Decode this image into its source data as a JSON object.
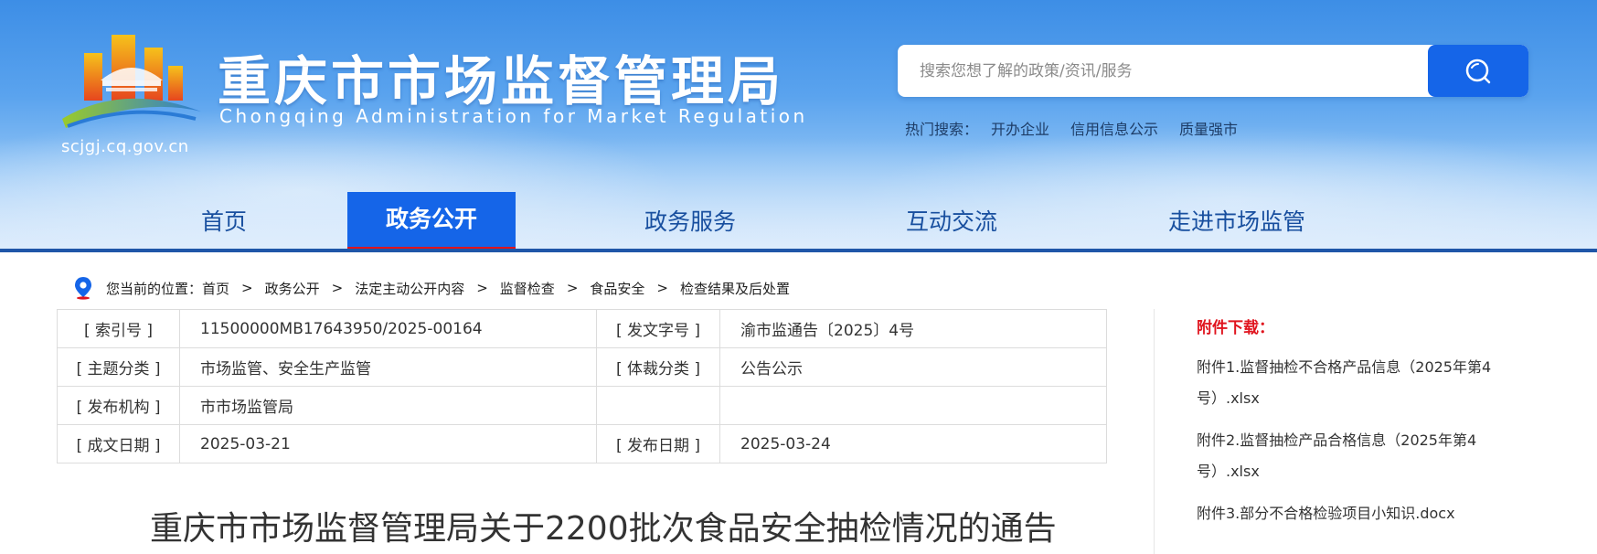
{
  "header": {
    "title": "重庆市市场监督管理局",
    "subtitle": "Chongqing  Administration for Market Regulation",
    "domain": "scjgj.cq.gov.cn"
  },
  "search": {
    "placeholder": "搜索您想了解的政策/资讯/服务",
    "value": "",
    "icon": "search-icon",
    "hot_label": "热门搜索：",
    "hot_links": [
      "开办企业",
      "信用信息公示",
      "质量强市"
    ]
  },
  "nav": {
    "items": [
      {
        "label": "首页",
        "active": false
      },
      {
        "label": "政务公开",
        "active": true
      },
      {
        "label": "政务服务",
        "active": false
      },
      {
        "label": "互动交流",
        "active": false
      },
      {
        "label": "走进市场监管",
        "active": false
      }
    ]
  },
  "breadcrumb": {
    "prefix": "您当前的位置：",
    "items": [
      "首页",
      "政务公开",
      "法定主动公开内容",
      "监督检查",
      "食品安全",
      "检查结果及后处置"
    ],
    "separator": ">"
  },
  "meta": {
    "rows": [
      {
        "k1": "[ 索引号 ]",
        "v1": "11500000MB17643950/2025-00164",
        "k2": "[ 发文字号 ]",
        "v2": "渝市监通告〔2025〕4号"
      },
      {
        "k1": "[ 主题分类 ]",
        "v1": "市场监管、安全生产监管",
        "k2": "[ 体裁分类 ]",
        "v2": "公告公示"
      },
      {
        "k1": "[ 发布机构 ]",
        "v1": "市市场监管局",
        "k2": "",
        "v2": ""
      },
      {
        "k1": "[ 成文日期 ]",
        "v1": "2025-03-21",
        "k2": "[ 发布日期 ]",
        "v2": "2025-03-24"
      }
    ]
  },
  "article": {
    "title": "重庆市市场监督管理局关于2200批次食品安全抽检情况的通告"
  },
  "attachments": {
    "title": "附件下载：",
    "items": [
      "附件1.监督抽检不合格产品信息（2025年第4号）.xlsx",
      "附件2.监督抽检产品合格信息（2025年第4号）.xlsx",
      "附件3.部分不合格检验项目小知识.docx"
    ]
  },
  "colors": {
    "primary": "#1565e8",
    "accent_red": "#e0141e",
    "nav_text": "#184f9f"
  }
}
